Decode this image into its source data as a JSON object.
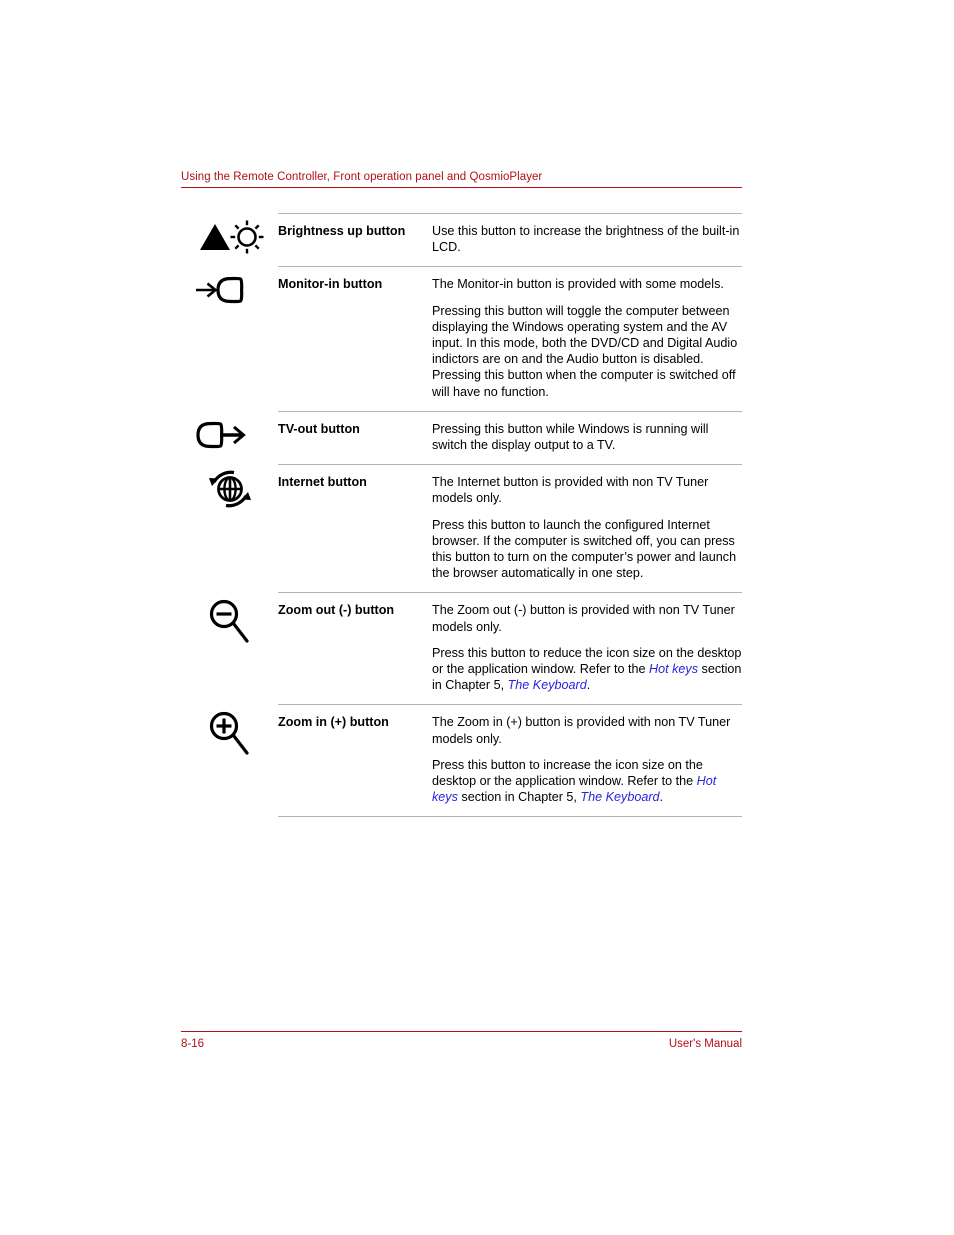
{
  "header": {
    "running_head": "Using the Remote Controller, Front operation panel and QosmioPlayer",
    "rule_color": "#b01116"
  },
  "footer": {
    "page_number": "8-16",
    "manual_label": "User's Manual",
    "rule_color": "#b01116"
  },
  "colors": {
    "accent_red": "#b01116",
    "link_blue": "#2525e0",
    "rule_gray": "#b3b3b3",
    "text_black": "#000000"
  },
  "table": {
    "rows": [
      {
        "icon": "brightness-up-icon",
        "label": "Brightness up button",
        "paragraphs": [
          {
            "segments": [
              {
                "text": "Use this button to increase the brightness of the built-in LCD.",
                "style": "plain"
              }
            ]
          }
        ]
      },
      {
        "icon": "monitor-in-icon",
        "label": "Monitor-in button",
        "paragraphs": [
          {
            "segments": [
              {
                "text": "The Monitor-in button is provided with some models.",
                "style": "plain"
              }
            ]
          },
          {
            "segments": [
              {
                "text": "Pressing this button will toggle the computer between displaying the Windows operating system and the AV input. In this mode, both the DVD/CD and Digital Audio indictors are on and the Audio button is disabled. Pressing this button when the computer is switched off will have no function.",
                "style": "plain"
              }
            ]
          }
        ]
      },
      {
        "icon": "tv-out-icon",
        "label": "TV-out button",
        "paragraphs": [
          {
            "segments": [
              {
                "text": "Pressing this button while Windows is running will switch the display output to a TV.",
                "style": "plain"
              }
            ]
          }
        ]
      },
      {
        "icon": "internet-globe-icon",
        "label": "Internet button",
        "paragraphs": [
          {
            "segments": [
              {
                "text": "The Internet button is provided with non TV Tuner models only.",
                "style": "plain"
              }
            ]
          },
          {
            "segments": [
              {
                "text": "Press this button to launch the configured Internet browser. If the computer is switched off, you can press this button to turn on the computer’s power and launch the browser automatically in one step.",
                "style": "plain"
              }
            ]
          }
        ]
      },
      {
        "icon": "zoom-out-magnifier-icon",
        "label": "Zoom out (-) button",
        "paragraphs": [
          {
            "segments": [
              {
                "text": "The Zoom out (-) button is provided with non TV Tuner models only.",
                "style": "plain"
              }
            ]
          },
          {
            "segments": [
              {
                "text": "Press this button to reduce the icon size on the desktop or the application window. Refer to the ",
                "style": "plain"
              },
              {
                "text": "Hot keys",
                "style": "link"
              },
              {
                "text": " section in Chapter 5, ",
                "style": "plain"
              },
              {
                "text": "The Keyboard",
                "style": "link"
              },
              {
                "text": ".",
                "style": "plain"
              }
            ]
          }
        ]
      },
      {
        "icon": "zoom-in-magnifier-icon",
        "label": "Zoom in (+) button",
        "paragraphs": [
          {
            "segments": [
              {
                "text": "The Zoom in (+) button is provided with non TV Tuner models only.",
                "style": "plain"
              }
            ]
          },
          {
            "segments": [
              {
                "text": "Press this button to increase the icon size on the desktop or the application window. Refer to the ",
                "style": "plain"
              },
              {
                "text": "Hot keys",
                "style": "link"
              },
              {
                "text": " section in Chapter 5, ",
                "style": "plain"
              },
              {
                "text": "The Keyboard",
                "style": "link"
              },
              {
                "text": ".",
                "style": "plain"
              }
            ]
          }
        ]
      }
    ]
  }
}
